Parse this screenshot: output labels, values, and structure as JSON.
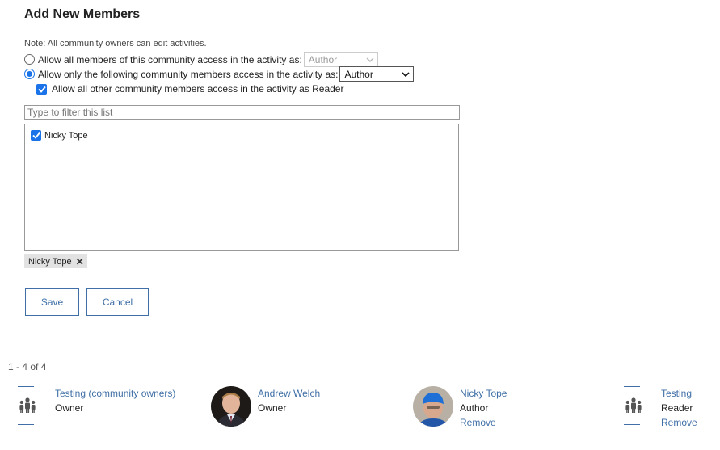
{
  "page": {
    "title": "Add New Members",
    "note": "Note: All community owners can edit activities."
  },
  "access": {
    "option_all_label": "Allow all members of this community access in the activity as:",
    "option_all_role": "Author",
    "option_only_label": "Allow only the following community members access in the activity as:",
    "option_only_role": "Author",
    "reader_label": "Allow all other community members access in the activity as Reader"
  },
  "filter": {
    "placeholder": "Type to filter this list"
  },
  "list": {
    "items": [
      {
        "label": "Nicky Tope",
        "checked": true
      }
    ]
  },
  "selected_tags": [
    {
      "label": "Nicky Tope"
    }
  ],
  "buttons": {
    "save": "Save",
    "cancel": "Cancel"
  },
  "members_count": "1 - 4 of 4",
  "members": [
    {
      "name": "Testing (community owners)",
      "role": "Owner",
      "avatar": "group-icon"
    },
    {
      "name": "Andrew Welch",
      "role": "Owner",
      "avatar": "photo"
    },
    {
      "name": "Nicky Tope",
      "role": "Author",
      "remove": "Remove",
      "avatar": "photo"
    },
    {
      "name": "Testing",
      "role": "Reader",
      "remove": "Remove",
      "avatar": "group-icon"
    }
  ],
  "colors": {
    "accent": "#1a73e8",
    "link": "#3f6fa6"
  }
}
